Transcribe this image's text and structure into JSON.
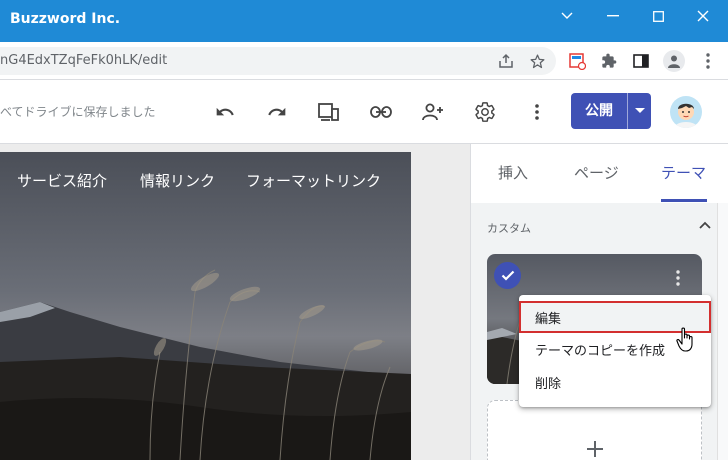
{
  "window": {
    "title": "Buzzword Inc."
  },
  "browser": {
    "url": "nG4EdxTZqFeFk0hLK/edit"
  },
  "toolbar": {
    "saved_status": "べてドライブに保存しました",
    "publish_label": "公開"
  },
  "site": {
    "nav": [
      "サービス紹介",
      "情報リンク",
      "フォーマットリンク"
    ]
  },
  "panel": {
    "tabs": [
      "挿入",
      "ページ",
      "テーマ"
    ],
    "active_tab": "テーマ",
    "section_label": "カスタム",
    "add_symbol": "+"
  },
  "context_menu": {
    "items": [
      "編集",
      "テーマのコピーを作成",
      "削除"
    ],
    "highlighted": "編集"
  },
  "colors": {
    "titlebar": "#1f8ad6",
    "accent": "#3f51b5",
    "highlight_border": "#d32f2f"
  },
  "icons": [
    "undo-icon",
    "redo-icon",
    "device-preview-icon",
    "link-icon",
    "share-person-add-icon",
    "settings-gear-icon",
    "more-vert-icon"
  ]
}
